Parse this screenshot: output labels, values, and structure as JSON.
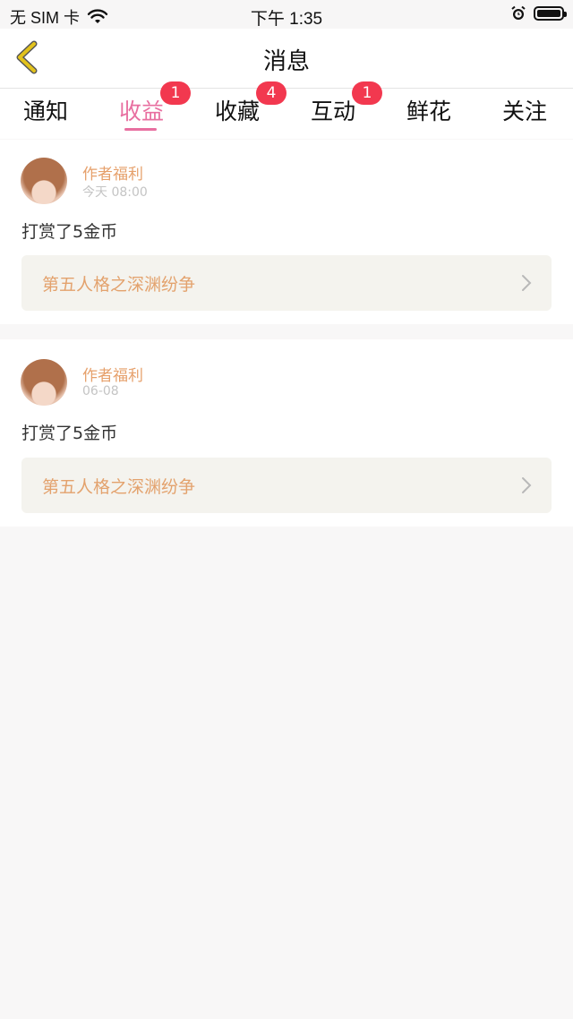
{
  "status_bar": {
    "carrier": "无 SIM 卡",
    "time": "下午 1:35",
    "icons": [
      "wifi-icon",
      "alarm-icon",
      "battery-icon"
    ]
  },
  "nav": {
    "title": "消息",
    "back_icon": "chevron-left-icon"
  },
  "tabs": [
    {
      "label": "通知",
      "badge": ""
    },
    {
      "label": "收益",
      "badge": "1"
    },
    {
      "label": "收藏",
      "badge": "4"
    },
    {
      "label": "互动",
      "badge": "1"
    },
    {
      "label": "鲜花",
      "badge": ""
    },
    {
      "label": "关注",
      "badge": ""
    }
  ],
  "active_tab": "收益",
  "messages": [
    {
      "author": "作者福利",
      "time": "今天 08:00",
      "text": "打赏了5金币",
      "book_title": "第五人格之深渊纷争"
    },
    {
      "author": "作者福利",
      "time": "06-08",
      "text": "打赏了5金币",
      "book_title": "第五人格之深渊纷争"
    }
  ],
  "colors": {
    "accent_pink": "#e86fa0",
    "badge_red": "#f2384f",
    "author_orange": "#e6a06b",
    "back_yellow": "#e2c21c"
  }
}
